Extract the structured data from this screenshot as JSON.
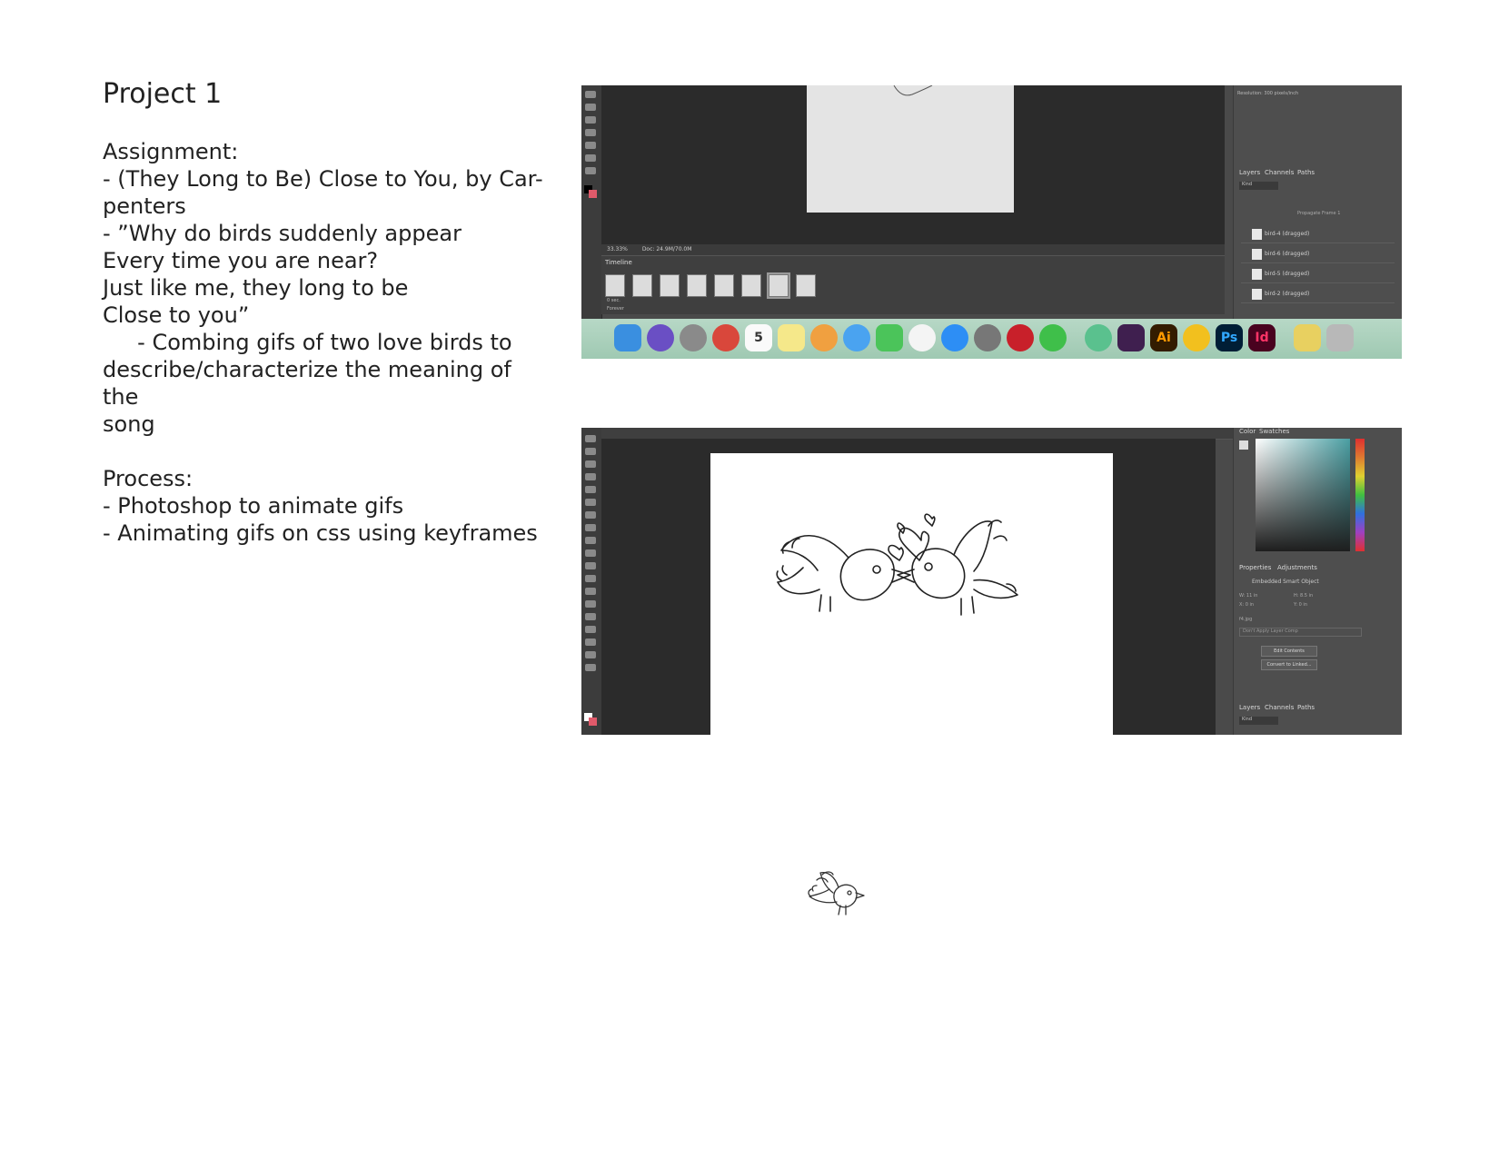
{
  "title": "Project 1",
  "assignment": {
    "heading": "Assignment:",
    "lines": [
      "- (They Long to Be) Close to You, by Car-",
      "penters",
      "- ”Why do birds suddenly appear",
      "Every time you are near?",
      "Just like me, they long to be",
      "Close to you”",
      "     - Combing gifs of two love birds to",
      "describe/characterize the meaning of the",
      "song"
    ]
  },
  "process": {
    "heading": "Process:",
    "lines": [
      "- Photoshop to animate gifs",
      "- Animating gifs on css using keyframes"
    ]
  },
  "screenshot1": {
    "status_zoom": "33.33%",
    "status_doc": "Doc: 24.9M/70.0M",
    "timeline_label": "Timeline",
    "frame_delay": "0 sec.",
    "loop_option": "Forever",
    "panel_tabs": [
      "Layers",
      "Channels",
      "Paths"
    ],
    "resolution": "Resolution: 300 pixels/inch",
    "kind_filter": "Kind",
    "propagate": "Propagate Frame 1",
    "layers": [
      "bird-4 (dragged)",
      "bird-6 (dragged)",
      "bird-5 (dragged)",
      "bird-2 (dragged)"
    ],
    "dock_apps": [
      "Finder",
      "Siri",
      "Launchpad",
      "Chrome",
      "Calendar",
      "Notes",
      "Photos",
      "Messages",
      "FaceTime",
      "iTunes",
      "App Store",
      "System Preferences",
      "ExpressVPN",
      "WeChat",
      "Atom",
      "Slack",
      "Illustrator",
      "Cyberduck",
      "Photoshop",
      "InDesign",
      "Preview",
      "Trash"
    ],
    "calendar_day": "5"
  },
  "screenshot2": {
    "panel_tabs_top": [
      "Color",
      "Swatches"
    ],
    "properties_tabs": [
      "Properties",
      "Adjustments"
    ],
    "properties_title": "Embedded Smart Object",
    "width": "W: 11 in",
    "height": "H: 8.5 in",
    "x": "X: 0 in",
    "y": "Y: 0 in",
    "file": "f4.jpg",
    "comp": "Don't Apply Layer Comp",
    "edit_button": "Edit Contents",
    "convert_button": "Convert to Linked...",
    "layer_tabs": [
      "Layers",
      "Channels",
      "Paths"
    ],
    "kind_filter": "Kind"
  }
}
